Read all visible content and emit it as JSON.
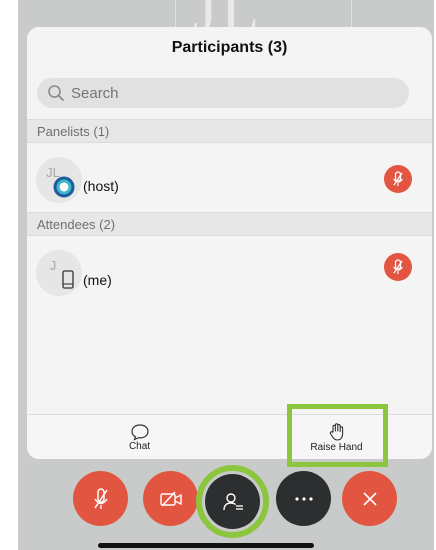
{
  "background": {
    "letters": "JL"
  },
  "participants": {
    "title": "Participants (3)",
    "search": {
      "placeholder": "Search"
    },
    "sections": [
      {
        "label": "Panelists (1)",
        "items": [
          {
            "initials": "JL",
            "name": "(host)",
            "badge_icon": "host-badge-icon",
            "action_icon": "mic-muted-icon"
          }
        ]
      },
      {
        "label": "Attendees (2)",
        "items": [
          {
            "initials": "J",
            "name": "(me)",
            "badge_icon": "device-phone-icon",
            "action_icon": "mic-muted-icon"
          }
        ]
      }
    ],
    "tabs": [
      {
        "label": "Chat",
        "icon": "chat-bubble-icon"
      },
      {
        "label": "Raise Hand",
        "icon": "raise-hand-icon"
      }
    ]
  },
  "toolbar": {
    "buttons": [
      {
        "name": "mute",
        "icon": "mic-muted-icon",
        "color": "#e25541"
      },
      {
        "name": "video",
        "icon": "video-off-icon",
        "color": "#e25541"
      },
      {
        "name": "participants",
        "icon": "participants-icon",
        "color": "#2d2e30"
      },
      {
        "name": "more",
        "icon": "more-dots-icon",
        "color": "#2d2e30"
      },
      {
        "name": "leave",
        "icon": "close-icon",
        "color": "#e25541"
      }
    ]
  },
  "colors": {
    "accent_red": "#e25541",
    "highlight_green": "#8cc63f",
    "panel": "#f4f4f4"
  }
}
